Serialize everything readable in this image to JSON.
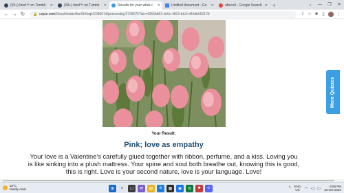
{
  "browser": {
    "tabs": [
      {
        "title": "(99+) tired™ on Tumblr",
        "favicon_color": "#36465d",
        "active": false
      },
      {
        "title": "(99+) tired™ on Tumblr",
        "favicon_color": "#36465d",
        "active": false
      },
      {
        "title": "Results for your what c",
        "favicon_color": "#3aa0e3",
        "active": true
      },
      {
        "title": "Untitled document - Go",
        "favicon_color": "#4285f4",
        "active": false
      },
      {
        "title": "aftecall - Google Search",
        "favicon_color": "#ea4335",
        "active": false
      }
    ],
    "url_host": "uquiz.com",
    "url_path": "/Result/static/lite/Sh5oqk/2280674/personality/2708075?&u=4356bb63-cb5c-4833-b62c-f83db653129"
  },
  "page": {
    "result_label": "Your Result:",
    "result_title": "Pink; love as empathy",
    "result_description": "Your love is a Valentine's carefully glued together with ribbon, perfume, and a kiss. Loving you is like sinking into a plush mattress. Your spine and soul both breathe out, knowing this is good, this is right. Love is your second nature, love is your language. Love!",
    "side_button": "More Quizzes",
    "accent": "#3aa0e3",
    "title_color": "#1f4f74"
  },
  "taskbar": {
    "weather_temp": "18°C",
    "weather_desc": "Mostly clear",
    "lang_line1": "ENG",
    "lang_line2": "US",
    "time": "8:58 PM",
    "date": "16-Oct-2022"
  }
}
